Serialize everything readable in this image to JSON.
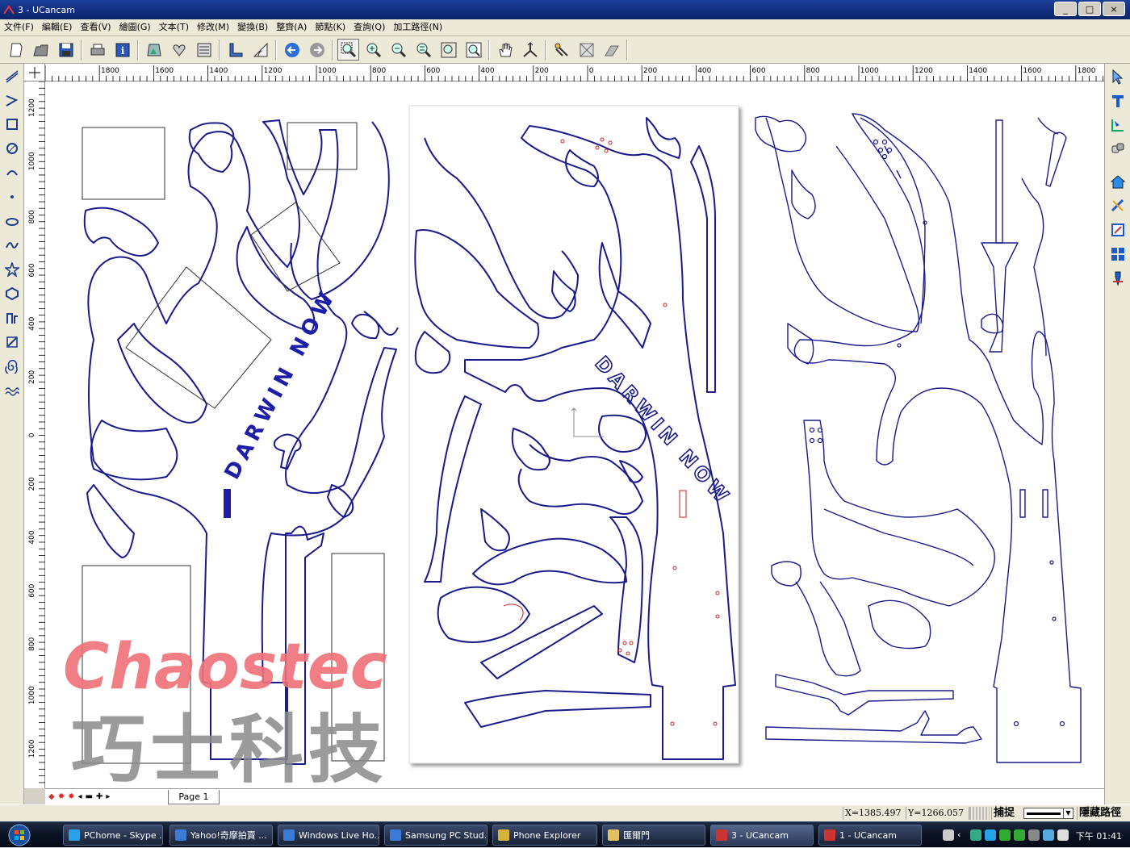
{
  "window": {
    "title": "3 - UCancam",
    "controls": [
      "_",
      "□",
      "×"
    ]
  },
  "menu": [
    "文件(F)",
    "編輯(E)",
    "查看(V)",
    "繪圖(G)",
    "文本(T)",
    "修改(M)",
    "變換(B)",
    "整齊(A)",
    "節點(K)",
    "查詢(Q)",
    "加工路徑(N)"
  ],
  "ruler": {
    "h_labels": [
      "1800",
      "1600",
      "1400",
      "1200",
      "1000",
      "800",
      "600",
      "400",
      "200",
      "0",
      "200",
      "400",
      "600",
      "800",
      "1000",
      "1200",
      "1400",
      "1600",
      "1800"
    ],
    "v_labels": [
      "1200",
      "1000",
      "800",
      "600",
      "400",
      "200",
      "0",
      "200",
      "400",
      "600",
      "800",
      "1000",
      "1200"
    ]
  },
  "canvas": {
    "text_darwin_now": "DARWIN NOW",
    "watermark_latin": "Chaostec",
    "watermark_chinese": "巧士科技"
  },
  "pagebar": {
    "nav_symbols": [
      "◂",
      "▬",
      "✚",
      "▸"
    ],
    "page_tab": "Page 1"
  },
  "status": {
    "x": "X=1385.497",
    "y": "Y=1266.057",
    "snap": "捕捉",
    "hide_path": "隱藏路徑"
  },
  "taskbar": {
    "tasks": [
      {
        "label": "PChome - Skype ...",
        "icon_color": "#2aa0e8"
      },
      {
        "label": "Yahoo!奇摩拍賣 ...",
        "icon_color": "#3b7bd6"
      },
      {
        "label": "Windows Live Ho...",
        "icon_color": "#3b7bd6"
      },
      {
        "label": "Samsung PC Stud...",
        "icon_color": "#3b7bd6"
      },
      {
        "label": "Phone Explorer",
        "icon_color": "#d6b43b"
      },
      {
        "label": "匯爾門",
        "icon_color": "#e0c060"
      },
      {
        "label": "3 - UCancam",
        "icon_color": "#c33"
      },
      {
        "label": "1 - UCancam",
        "icon_color": "#c33"
      }
    ],
    "clock": "下午 01:41"
  },
  "colors": {
    "cut_line": "#1a1a8c",
    "text_blue": "#1d1daa",
    "watermark_red": "#f07078",
    "watermark_gray": "#8a8a8a",
    "marker_red": "#d02020"
  }
}
